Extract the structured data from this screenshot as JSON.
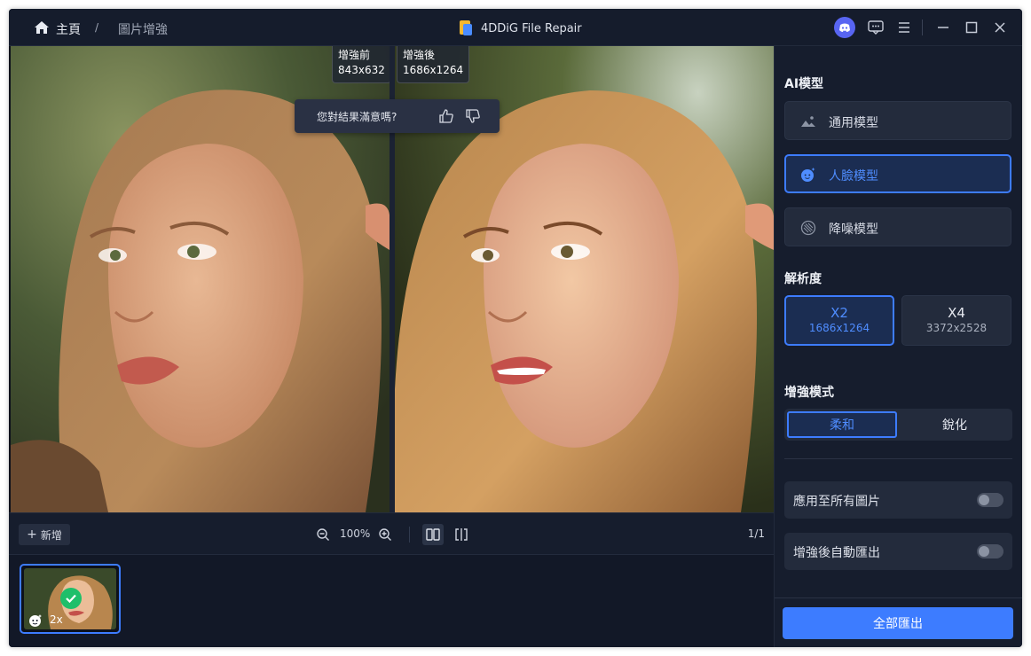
{
  "titlebar": {
    "breadcrumb_home": "主頁",
    "breadcrumb_sep": "/",
    "breadcrumb_current": "圖片增強",
    "app_name": "4DDiG File Repair",
    "icons": [
      "discord-icon",
      "feedback-icon",
      "menu-icon",
      "minimize-icon",
      "maximize-icon",
      "close-icon"
    ]
  },
  "viewer": {
    "before_label": "增強前",
    "before_size": "843x632",
    "after_label": "增強後",
    "after_size": "1686x1264",
    "feedback_question": "您對結果滿意嗎?"
  },
  "toolbar": {
    "add_label": "新增",
    "zoom_level": "100%",
    "page_count": "1/1"
  },
  "strip": {
    "thumb_scale": "2x"
  },
  "panel": {
    "ai_model_title": "AI模型",
    "models": [
      {
        "label": "通用模型",
        "icon": "landscape-icon",
        "active": false
      },
      {
        "label": "人臉模型",
        "icon": "face-icon",
        "active": true
      },
      {
        "label": "降噪模型",
        "icon": "denoise-icon",
        "active": false
      }
    ],
    "resolution_title": "解析度",
    "resolutions": [
      {
        "scale": "X2",
        "size": "1686x1264",
        "active": true
      },
      {
        "scale": "X4",
        "size": "3372x2528",
        "active": false
      }
    ],
    "mode_title": "增強模式",
    "modes": [
      {
        "label": "柔和",
        "active": true
      },
      {
        "label": "銳化",
        "active": false
      }
    ],
    "toggles": [
      {
        "label": "應用至所有圖片",
        "on": false
      },
      {
        "label": "增強後自動匯出",
        "on": false
      }
    ],
    "export_label": "全部匯出"
  },
  "colors": {
    "accent": "#3d7cff",
    "background": "#121827",
    "panel": "#161d2d",
    "success": "#1fbf6a"
  }
}
